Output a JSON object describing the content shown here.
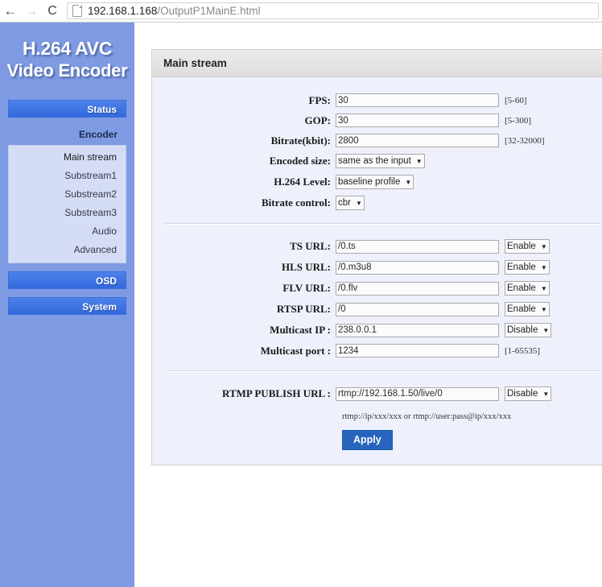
{
  "browser": {
    "back_icon": "back-arrow-icon",
    "forward_icon": "forward-arrow-icon",
    "reload_icon": "reload-icon",
    "reload_glyph": "C",
    "back_glyph": "←",
    "forward_glyph": "→",
    "url_host": "192.168.1.168",
    "url_path": "/OutputP1MainE.html"
  },
  "sidebar": {
    "logo_line1": "H.264 AVC",
    "logo_line2": "Video Encoder",
    "status_label": "Status",
    "encoder_label": "Encoder",
    "submenu": [
      {
        "label": "Main stream"
      },
      {
        "label": "Substream1"
      },
      {
        "label": "Substream2"
      },
      {
        "label": "Substream3"
      },
      {
        "label": "Audio"
      },
      {
        "label": "Advanced"
      }
    ],
    "osd_label": "OSD",
    "system_label": "System",
    "colors": {
      "background": "#7e9ae2",
      "button": "#3b72e0",
      "submenu_background": "#d5dcf5"
    }
  },
  "panel": {
    "title": "Main stream",
    "encoding": [
      {
        "label": "FPS:",
        "value": "30",
        "hint": "[5-60]"
      },
      {
        "label": "GOP:",
        "value": "30",
        "hint": "[5-300]"
      },
      {
        "label": "Bitrate(kbit):",
        "value": "2800",
        "hint": "[32-32000]"
      }
    ],
    "selects": [
      {
        "label": "Encoded size:",
        "value": "same as the input"
      },
      {
        "label": "H.264 Level:",
        "value": "baseline profile"
      },
      {
        "label": "Bitrate control:",
        "value": "cbr"
      }
    ],
    "urls": [
      {
        "label": "TS URL:",
        "value": "/0.ts",
        "state": "Enable"
      },
      {
        "label": "HLS URL:",
        "value": "/0.m3u8",
        "state": "Enable"
      },
      {
        "label": "FLV URL:",
        "value": "/0.flv",
        "state": "Enable"
      },
      {
        "label": "RTSP URL:",
        "value": "/0",
        "state": "Enable"
      },
      {
        "label": "Multicast IP :",
        "value": "238.0.0.1",
        "state": "Disable"
      }
    ],
    "multicast_port": {
      "label": "Multicast port :",
      "value": "1234",
      "hint": "[1-65535]"
    },
    "rtmp": {
      "label": "RTMP PUBLISH URL :",
      "value": "rtmp://192.168.1.50/live/0",
      "state": "Disable",
      "note": "rtmp://ip/xxx/xxx or rtmp://user:pass@ip/xxx/xxx"
    },
    "apply_label": "Apply",
    "caret_glyph": "▼",
    "colors": {
      "header": "#e4e2e2",
      "body": "#eef1fb",
      "apply_button": "#2764be"
    }
  }
}
